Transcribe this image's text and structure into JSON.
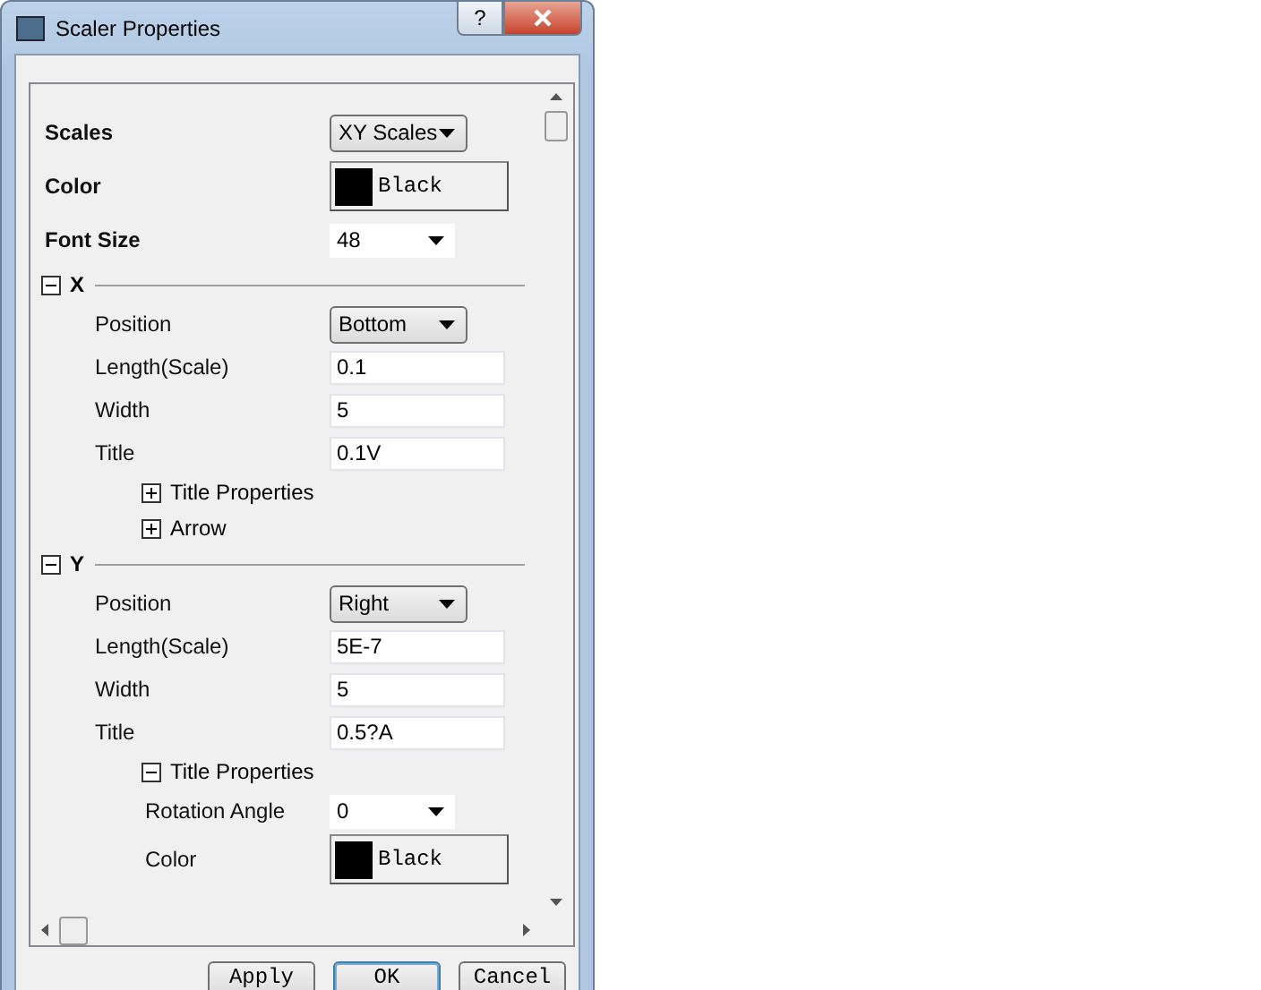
{
  "window": {
    "title": "Scaler Properties",
    "help_button": "?"
  },
  "properties": [
    {
      "kind": "dropdown",
      "label": "Scales",
      "value": "XY Scales"
    },
    {
      "kind": "color",
      "label": "Color",
      "value": "Black",
      "color": "#000000"
    },
    {
      "kind": "combo",
      "label": "Font Size",
      "value": "48"
    },
    {
      "kind": "section",
      "label": "X",
      "expanded": true,
      "children": [
        {
          "kind": "dropdown",
          "label": "Position",
          "value": "Bottom"
        },
        {
          "kind": "text",
          "label": "Length(Scale)",
          "value": "0.1"
        },
        {
          "kind": "text",
          "label": "Width",
          "value": "5"
        },
        {
          "kind": "text",
          "label": "Title",
          "value": "0.1V"
        },
        {
          "kind": "group",
          "label": "Title Properties",
          "expanded": false
        },
        {
          "kind": "group",
          "label": "Arrow",
          "expanded": false
        }
      ]
    },
    {
      "kind": "section",
      "label": "Y",
      "expanded": true,
      "children": [
        {
          "kind": "dropdown",
          "label": "Position",
          "value": "Right"
        },
        {
          "kind": "text",
          "label": "Length(Scale)",
          "value": "5E-7"
        },
        {
          "kind": "text",
          "label": "Width",
          "value": "5"
        },
        {
          "kind": "text",
          "label": "Title",
          "value": "0.5?A"
        },
        {
          "kind": "group",
          "label": "Title Properties",
          "expanded": true,
          "children": [
            {
              "kind": "combo",
              "label": "Rotation Angle",
              "value": "0"
            },
            {
              "kind": "color",
              "label": "Color",
              "value": "Black",
              "color": "#000000"
            }
          ]
        }
      ]
    }
  ],
  "buttons": [
    "Apply",
    "OK",
    "Cancel"
  ]
}
